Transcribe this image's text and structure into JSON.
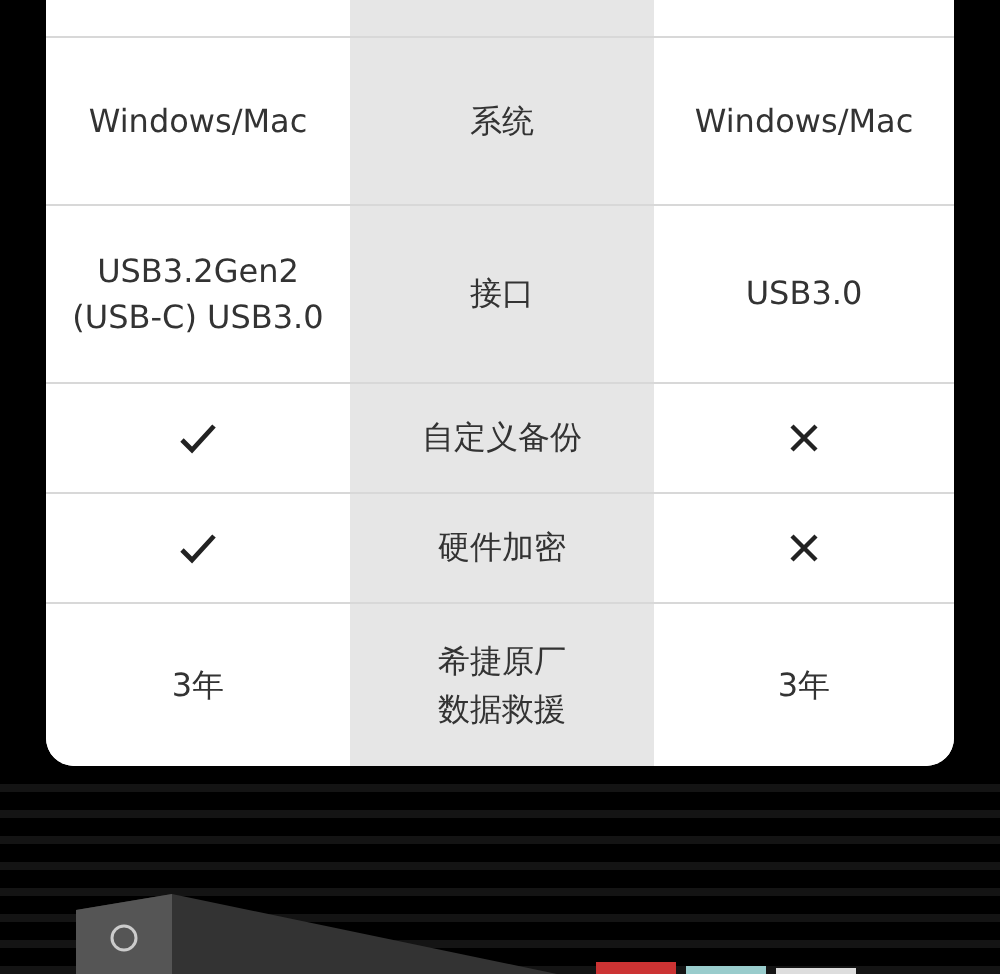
{
  "comparison_table": {
    "rows": [
      {
        "left": {
          "kind": "text",
          "text": "Windows/Mac"
        },
        "feature": "系统",
        "right": {
          "kind": "text",
          "text": "Windows/Mac"
        }
      },
      {
        "left": {
          "kind": "text",
          "text": "USB3.2Gen2\n(USB-C) USB3.0"
        },
        "feature": "接口",
        "right": {
          "kind": "text",
          "text": "USB3.0"
        }
      },
      {
        "left": {
          "kind": "check"
        },
        "feature": "自定义备份",
        "right": {
          "kind": "cross"
        }
      },
      {
        "left": {
          "kind": "check"
        },
        "feature": "硬件加密",
        "right": {
          "kind": "cross"
        }
      },
      {
        "left": {
          "kind": "text",
          "text": "3年"
        },
        "feature": "希捷原厂数据救援",
        "right": {
          "kind": "text",
          "text": "3年"
        }
      }
    ]
  }
}
